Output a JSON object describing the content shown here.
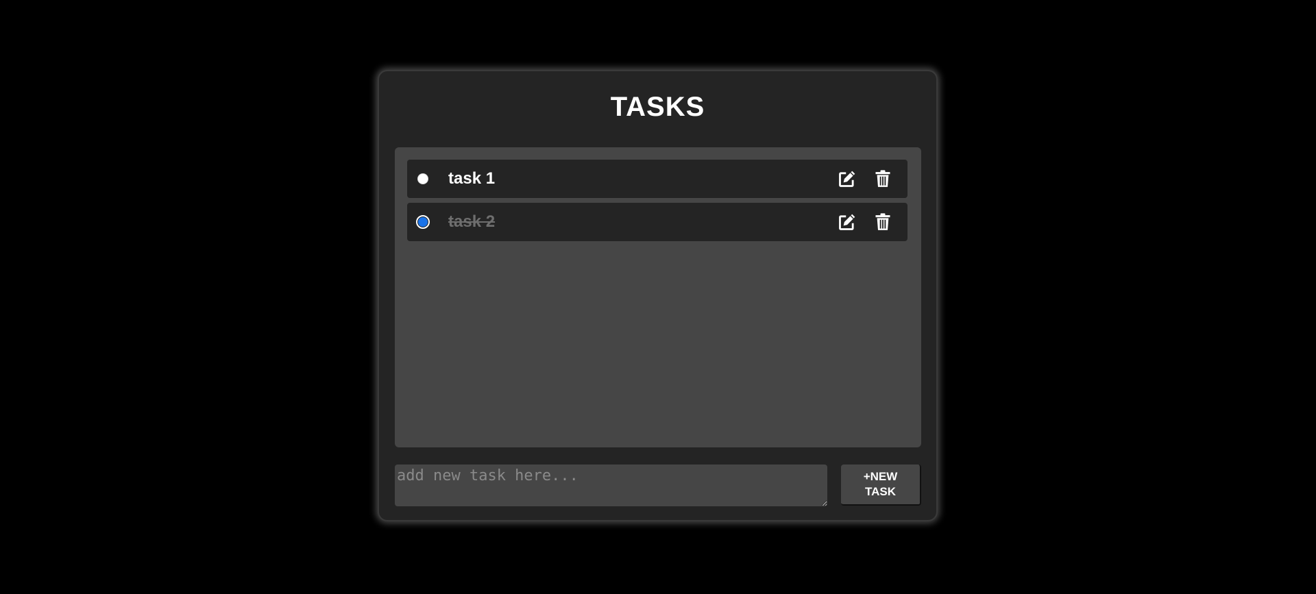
{
  "app": {
    "title": "TASKS"
  },
  "tasks": [
    {
      "label": "task 1",
      "completed": false
    },
    {
      "label": "task 2",
      "completed": true
    }
  ],
  "icons": {
    "edit": "edit-icon",
    "delete": "trash-icon"
  },
  "new_task": {
    "placeholder": "add new task here...",
    "value": "",
    "button_label": "+NEW TASK"
  },
  "colors": {
    "background": "#000000",
    "card": "#242424",
    "panel": "#464646",
    "text": "#ffffff",
    "completed_text": "#6e6e6e",
    "radio_checked": "#1a73e8"
  }
}
